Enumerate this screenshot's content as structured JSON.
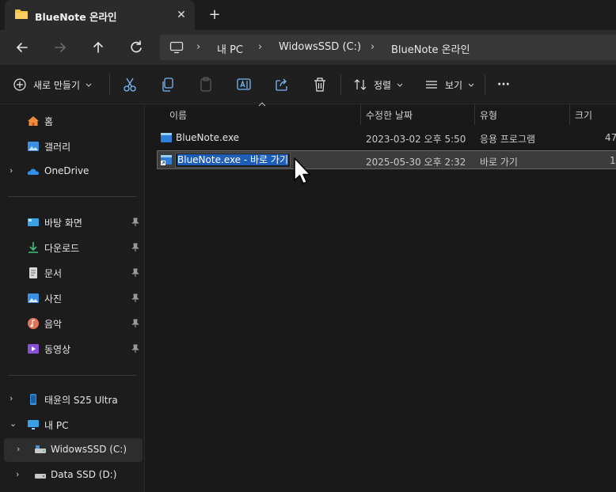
{
  "window": {
    "tab_title": "BlueNote 온라인",
    "close_glyph": "✕",
    "new_tab_glyph": "+"
  },
  "address": {
    "crumbs": [
      "내 PC",
      "WidowsSSD (C:)",
      "BlueNote 온라인"
    ],
    "separator": "›"
  },
  "command_bar": {
    "new_label": "새로 만들기",
    "sort_label": "정렬",
    "view_label": "보기",
    "more_label": "···"
  },
  "sidebar": {
    "home": "홈",
    "gallery": "갤러리",
    "onedrive": "OneDrive",
    "quick": [
      "바탕 화면",
      "다운로드",
      "문서",
      "사진",
      "음악",
      "동영상"
    ],
    "phone": "태윤의 S25 Ultra",
    "this_pc": "내 PC",
    "drive_c": "WidowsSSD (C:)",
    "drive_d": "Data SSD (D:)"
  },
  "columns": {
    "name": "이름",
    "modified": "수정한 날짜",
    "type": "유형",
    "size": "크기"
  },
  "files": [
    {
      "name": "BlueNote.exe",
      "modified": "2023-03-02 오후 5:50",
      "type": "응용 프로그램",
      "size": "47"
    },
    {
      "name": "BlueNote.exe - 바로 가기",
      "modified": "2025-05-30 오후 2:32",
      "type": "바로 가기",
      "size": "1"
    }
  ],
  "colors": {
    "accent": "#1d5fb8",
    "folder": "#f4c542",
    "background": "#191919"
  }
}
